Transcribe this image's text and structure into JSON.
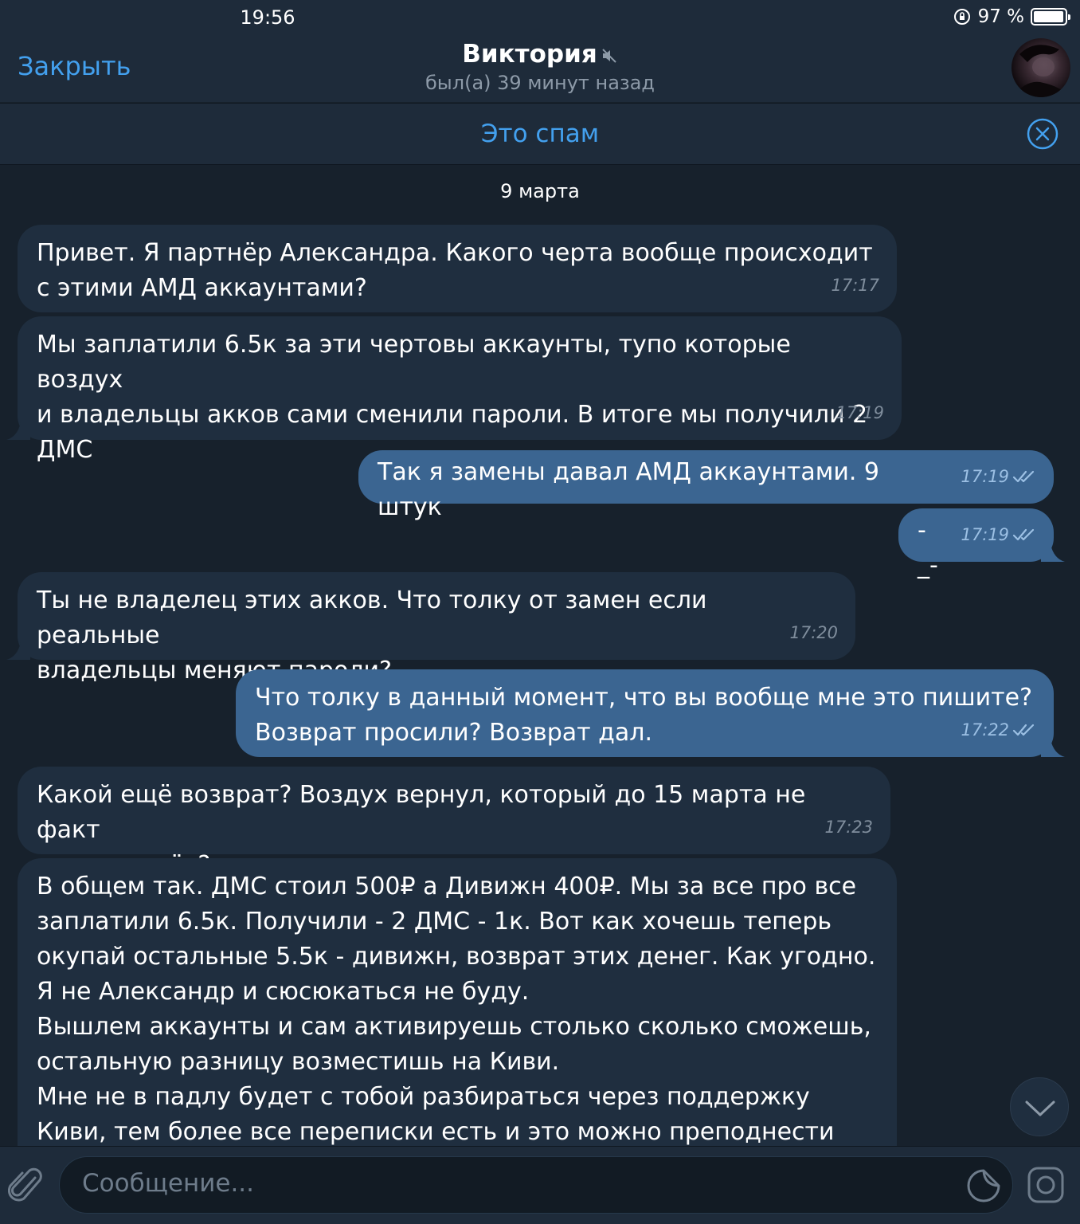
{
  "status_bar": {
    "time": "19:56",
    "battery_text": "97 %",
    "battery_level": 0.97
  },
  "header": {
    "close_label": "Закрыть",
    "contact_name": "Виктория",
    "contact_status": "был(а) 39 минут назад"
  },
  "spam_bar": {
    "label": "Это спам"
  },
  "date_chip": "9 марта",
  "messages": [
    {
      "direction": "in",
      "text": "Привет. Я партнёр Александра. Какого черта вообще происходит\nс этими АМД аккаунтами?",
      "time": "17:17"
    },
    {
      "direction": "in",
      "text": "Мы заплатили 6.5к за эти чертовы аккаунты, тупо которые воздух\nи владельцы акков сами сменили пароли. В итоге мы получили 2\nДМС",
      "time": "17:19"
    },
    {
      "direction": "out",
      "text": "Так я замены давал АМД аккаунтами. 9 штук",
      "time": "17:19",
      "read": true
    },
    {
      "direction": "out",
      "text": "-_-",
      "time": "17:19",
      "read": true
    },
    {
      "direction": "in",
      "text": "Ты не владелец этих акков. Что толку от замен если реальные\nвладельцы меняют пароли?",
      "time": "17:20"
    },
    {
      "direction": "out",
      "text": "Что толку в данный момент, что вы вообще мне это пишите?\nВозврат просили? Возврат дал.",
      "time": "17:22",
      "read": true
    },
    {
      "direction": "in",
      "text": "Какой ещё возврат? Воздух вернул, который до 15 марта не факт\nчто доживёт?",
      "time": "17:23"
    },
    {
      "direction": "in",
      "text": "В общем так. ДМС стоил 500₽ а Дивижн 400₽. Мы за все про все\nзаплатили 6.5к. Получили - 2 ДМС - 1к. Вот как хочешь теперь\nокупай остальные 5.5к - дивижн, возврат этих денег. Как угодно.\nЯ не Александр и сюсюкаться не буду.\nВышлем аккаунты и сам активируешь столько сколько сможешь,\nостальную разницу возместишь на Киви.\nМне не в падлу будет с тобой разбираться через поддержку\nКиви, тем более все переписки есть и это можно преподнести",
      "time": ""
    }
  ],
  "input": {
    "placeholder": "Сообщение..."
  },
  "colors": {
    "background": "#17212c",
    "incoming_bubble": "#1f2e3f",
    "outgoing_bubble": "#3b6591",
    "accent": "#43a0ee"
  },
  "icons": {
    "mute": "muted-speaker-icon",
    "spam_close": "circle-x-icon",
    "scroll_down": "chevron-down-icon",
    "attach": "paperclip-icon",
    "sticker": "sticker-icon",
    "camera": "camera-icon",
    "read_receipt": "double-check-icon"
  }
}
